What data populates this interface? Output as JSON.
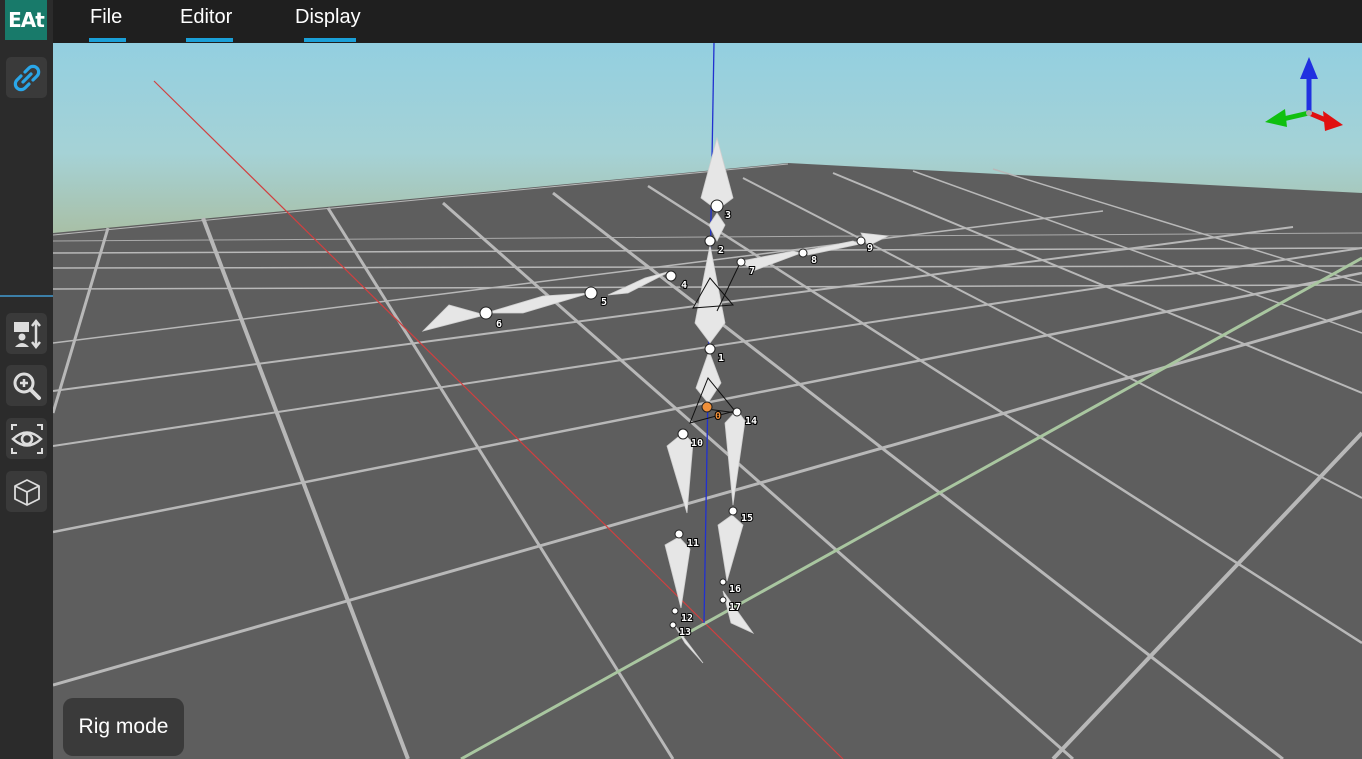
{
  "app": {
    "logo_text": "EAt"
  },
  "menu": {
    "file": "File",
    "editor": "Editor",
    "display": "Display"
  },
  "toolbar": {
    "items": [
      {
        "icon": "link-icon",
        "active": true
      },
      {
        "icon": "transform-gizmo-icon"
      },
      {
        "icon": "zoom-in-icon"
      },
      {
        "icon": "eye-view-icon"
      },
      {
        "icon": "cube-icon"
      }
    ]
  },
  "viewport": {
    "sky_top_color": "#93cfe0",
    "sky_bottom_color": "#a9bda0",
    "floor_color": "#5e5e5e",
    "grid_color": "#bdbdbd",
    "joints": [
      {
        "id": "0",
        "label": "0",
        "selected": true
      },
      {
        "id": "1",
        "label": "1"
      },
      {
        "id": "2",
        "label": "2"
      },
      {
        "id": "3",
        "label": "3"
      },
      {
        "id": "4",
        "label": "4"
      },
      {
        "id": "5",
        "label": "5"
      },
      {
        "id": "6",
        "label": "6"
      },
      {
        "id": "7",
        "label": "7"
      },
      {
        "id": "8",
        "label": "8"
      },
      {
        "id": "9",
        "label": "9"
      },
      {
        "id": "10",
        "label": "10"
      },
      {
        "id": "11",
        "label": "11"
      },
      {
        "id": "12",
        "label": "12"
      },
      {
        "id": "13",
        "label": "13"
      },
      {
        "id": "14",
        "label": "14"
      },
      {
        "id": "15",
        "label": "15"
      },
      {
        "id": "16",
        "label": "16"
      },
      {
        "id": "17",
        "label": "17"
      }
    ]
  },
  "status": {
    "mode": "Rig mode"
  },
  "colors": {
    "accent": "#1aa0d8",
    "logo_bg": "#187a6a",
    "selected_joint": "#f0903a",
    "axis_x": "#e02020",
    "axis_y": "#20c020",
    "axis_z": "#2030e0"
  }
}
